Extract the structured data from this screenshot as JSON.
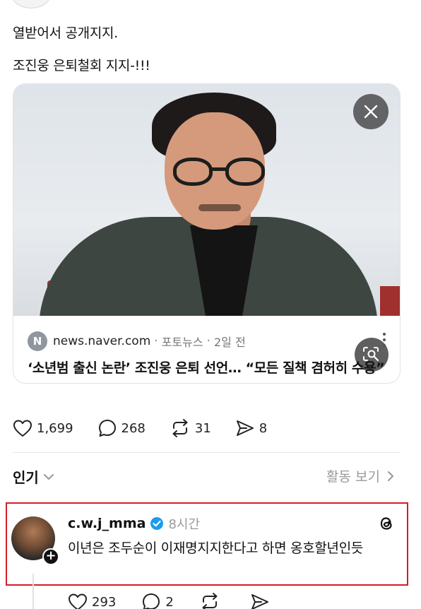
{
  "post": {
    "line1": "열받어서 공개지지.",
    "line2": "조진웅 은퇴철회 지지-!!!"
  },
  "link_card": {
    "close_icon": "close-icon",
    "lens_icon": "image-search-icon",
    "source_badge": "N",
    "domain": "news.naver.com",
    "separator": "·",
    "category": "포토뉴스",
    "time": "2일 전",
    "title": "‘소년범 출신 논란’ 조진웅 은퇴 선언… “모든 질책 겸허히 수용”"
  },
  "post_actions": {
    "likes": "1,699",
    "comments": "268",
    "reposts": "31",
    "shares": "8"
  },
  "sort": {
    "label": "인기",
    "activity_label": "활동 보기"
  },
  "reply": {
    "username": "c.w.j_mma",
    "time": "8시간",
    "text": "이년은 조두순이 이재명지지한다고 하면 옹호할년인듯",
    "likes": "293",
    "comments": "2"
  },
  "colors": {
    "verified": "#1d9bf0",
    "highlight": "#d21e28",
    "muted": "#999999"
  }
}
